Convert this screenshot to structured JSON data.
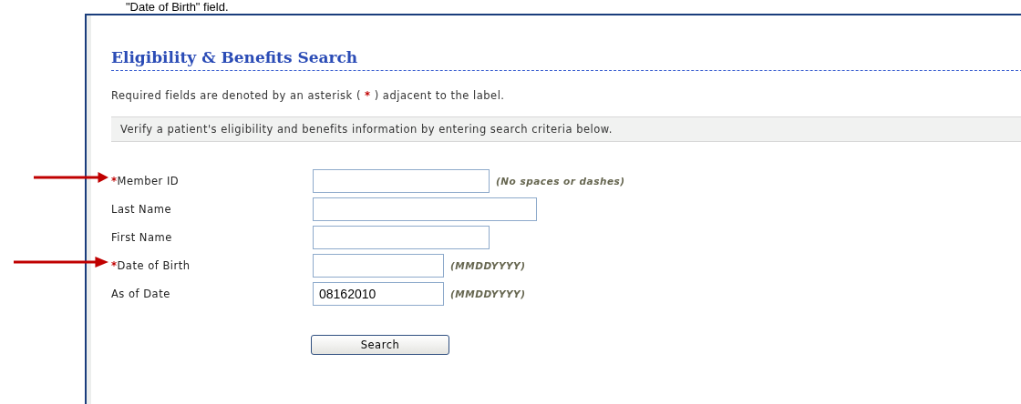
{
  "caption": "\"Date of Birth\" field.",
  "title": "Eligibility & Benefits Search",
  "required_note": {
    "before": "Required fields are denoted by an asterisk (",
    "mark": "*",
    "after": ") adjacent to the label."
  },
  "info": "Verify a patient's eligibility and benefits information by entering search criteria below.",
  "fields": [
    {
      "label": "Member ID",
      "required": true,
      "highlighted": true,
      "hint": "(No spaces or dashes)"
    },
    {
      "label": "Last Name",
      "required": false,
      "highlighted": false
    },
    {
      "label": "First Name",
      "required": false,
      "highlighted": false
    },
    {
      "label": "Date of Birth",
      "required": true,
      "highlighted": true,
      "hint": "(MMDDYYYY)"
    },
    {
      "label": "As of Date",
      "required": false,
      "highlighted": false,
      "value": "08162010",
      "hint": "(MMDDYYYY)"
    }
  ],
  "button": "Search"
}
